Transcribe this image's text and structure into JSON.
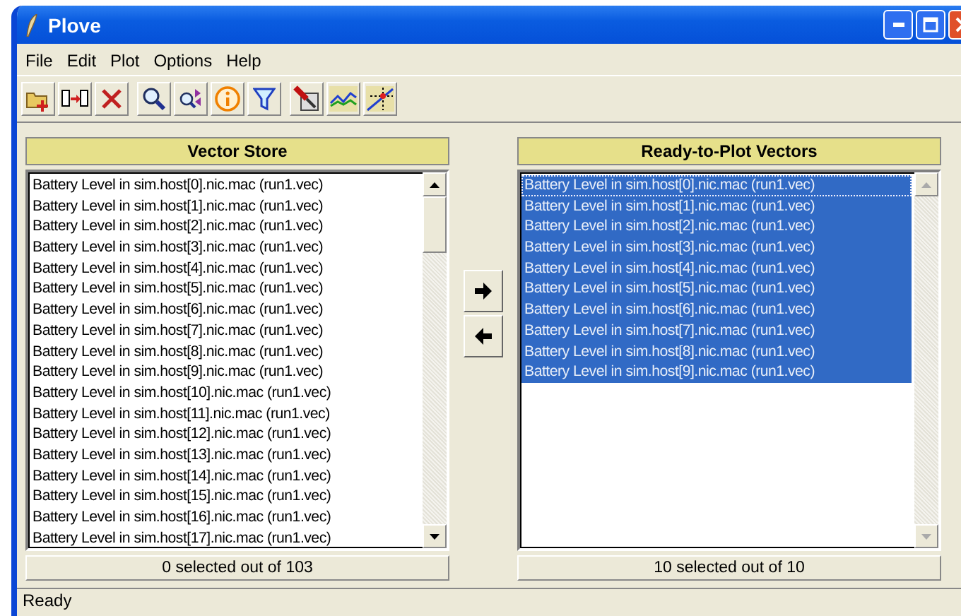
{
  "window": {
    "title": "Plove"
  },
  "menu": [
    "File",
    "Edit",
    "Plot",
    "Options",
    "Help"
  ],
  "toolbar": [
    {
      "kind": "open"
    },
    {
      "kind": "copy"
    },
    {
      "kind": "delete"
    },
    {
      "kind": "search"
    },
    {
      "kind": "replace"
    },
    {
      "kind": "info"
    },
    {
      "kind": "filter"
    },
    {
      "kind": "tool"
    },
    {
      "kind": "chart"
    },
    {
      "kind": "crosshair"
    }
  ],
  "vector_store": {
    "title": "Vector Store",
    "footer": "0 selected out of 103",
    "items": [
      {
        "label": "Battery Level in sim.host[0].nic.mac (run1.vec)",
        "selected": false
      },
      {
        "label": "Battery Level in sim.host[1].nic.mac (run1.vec)",
        "selected": false
      },
      {
        "label": "Battery Level in sim.host[2].nic.mac (run1.vec)",
        "selected": false
      },
      {
        "label": "Battery Level in sim.host[3].nic.mac (run1.vec)",
        "selected": false
      },
      {
        "label": "Battery Level in sim.host[4].nic.mac (run1.vec)",
        "selected": false
      },
      {
        "label": "Battery Level in sim.host[5].nic.mac (run1.vec)",
        "selected": false
      },
      {
        "label": "Battery Level in sim.host[6].nic.mac (run1.vec)",
        "selected": false
      },
      {
        "label": "Battery Level in sim.host[7].nic.mac (run1.vec)",
        "selected": false
      },
      {
        "label": "Battery Level in sim.host[8].nic.mac (run1.vec)",
        "selected": false
      },
      {
        "label": "Battery Level in sim.host[9].nic.mac (run1.vec)",
        "selected": false
      },
      {
        "label": "Battery Level in sim.host[10].nic.mac (run1.vec)",
        "selected": false
      },
      {
        "label": "Battery Level in sim.host[11].nic.mac (run1.vec)",
        "selected": false
      },
      {
        "label": "Battery Level in sim.host[12].nic.mac (run1.vec)",
        "selected": false
      },
      {
        "label": "Battery Level in sim.host[13].nic.mac (run1.vec)",
        "selected": false
      },
      {
        "label": "Battery Level in sim.host[14].nic.mac (run1.vec)",
        "selected": false
      },
      {
        "label": "Battery Level in sim.host[15].nic.mac (run1.vec)",
        "selected": false
      },
      {
        "label": "Battery Level in sim.host[16].nic.mac (run1.vec)",
        "selected": false
      },
      {
        "label": "Battery Level in sim.host[17].nic.mac (run1.vec)",
        "selected": false
      }
    ]
  },
  "ready_to_plot": {
    "title": "Ready-to-Plot Vectors",
    "footer": "10 selected out of 10",
    "items": [
      {
        "label": "Battery Level in sim.host[0].nic.mac (run1.vec)",
        "selected": true,
        "focused": true
      },
      {
        "label": "Battery Level in sim.host[1].nic.mac (run1.vec)",
        "selected": true,
        "focused": false
      },
      {
        "label": "Battery Level in sim.host[2].nic.mac (run1.vec)",
        "selected": true,
        "focused": false
      },
      {
        "label": "Battery Level in sim.host[3].nic.mac (run1.vec)",
        "selected": true,
        "focused": false
      },
      {
        "label": "Battery Level in sim.host[4].nic.mac (run1.vec)",
        "selected": true,
        "focused": false
      },
      {
        "label": "Battery Level in sim.host[5].nic.mac (run1.vec)",
        "selected": true,
        "focused": false
      },
      {
        "label": "Battery Level in sim.host[6].nic.mac (run1.vec)",
        "selected": true,
        "focused": false
      },
      {
        "label": "Battery Level in sim.host[7].nic.mac (run1.vec)",
        "selected": true,
        "focused": false
      },
      {
        "label": "Battery Level in sim.host[8].nic.mac (run1.vec)",
        "selected": true,
        "focused": false
      },
      {
        "label": "Battery Level in sim.host[9].nic.mac (run1.vec)",
        "selected": true,
        "focused": false
      }
    ]
  },
  "status_bar": "Ready"
}
